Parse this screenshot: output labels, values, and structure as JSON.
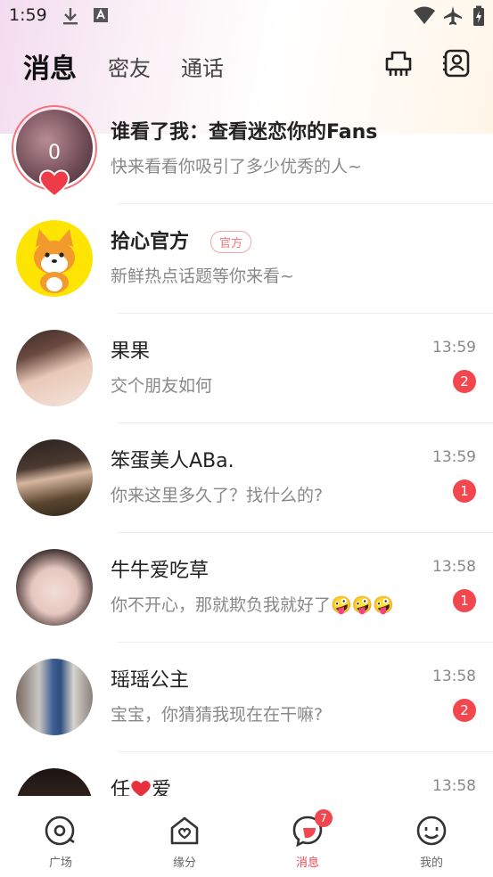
{
  "status_bar": {
    "time": "1:59"
  },
  "header": {
    "tabs": [
      "消息",
      "密友",
      "通话"
    ]
  },
  "visitors": {
    "count": "0",
    "title": "谁看了我：查看迷恋你的Fans",
    "subtitle": "快来看看你吸引了多少优秀的人~"
  },
  "official": {
    "name": "拾心官方",
    "tag": "官方",
    "message": "新鲜热点话题等你来看~"
  },
  "conversations": [
    {
      "name": "果果",
      "message": "交个朋友如何",
      "time": "13:59",
      "unread": "2"
    },
    {
      "name": "笨蛋美人ABa.",
      "message": "你来这里多久了？找什么的?",
      "time": "13:59",
      "unread": "1"
    },
    {
      "name": "牛牛爱吃草",
      "message": "你不开心，那就欺负我就好了🤪🤪🤪",
      "time": "13:58",
      "unread": "1"
    },
    {
      "name": "瑶瑶公主",
      "message": "宝宝，你猜猜我现在在干嘛?",
      "time": "13:58",
      "unread": "2"
    },
    {
      "name_pre": "任",
      "name_post": "爱",
      "time": "13:58"
    }
  ],
  "bottom_nav": {
    "items": [
      "广场",
      "缘分",
      "消息",
      "我的"
    ],
    "message_badge": "7"
  },
  "colors": {
    "accent": "#f2474f",
    "official_yellow": "#fde402"
  }
}
